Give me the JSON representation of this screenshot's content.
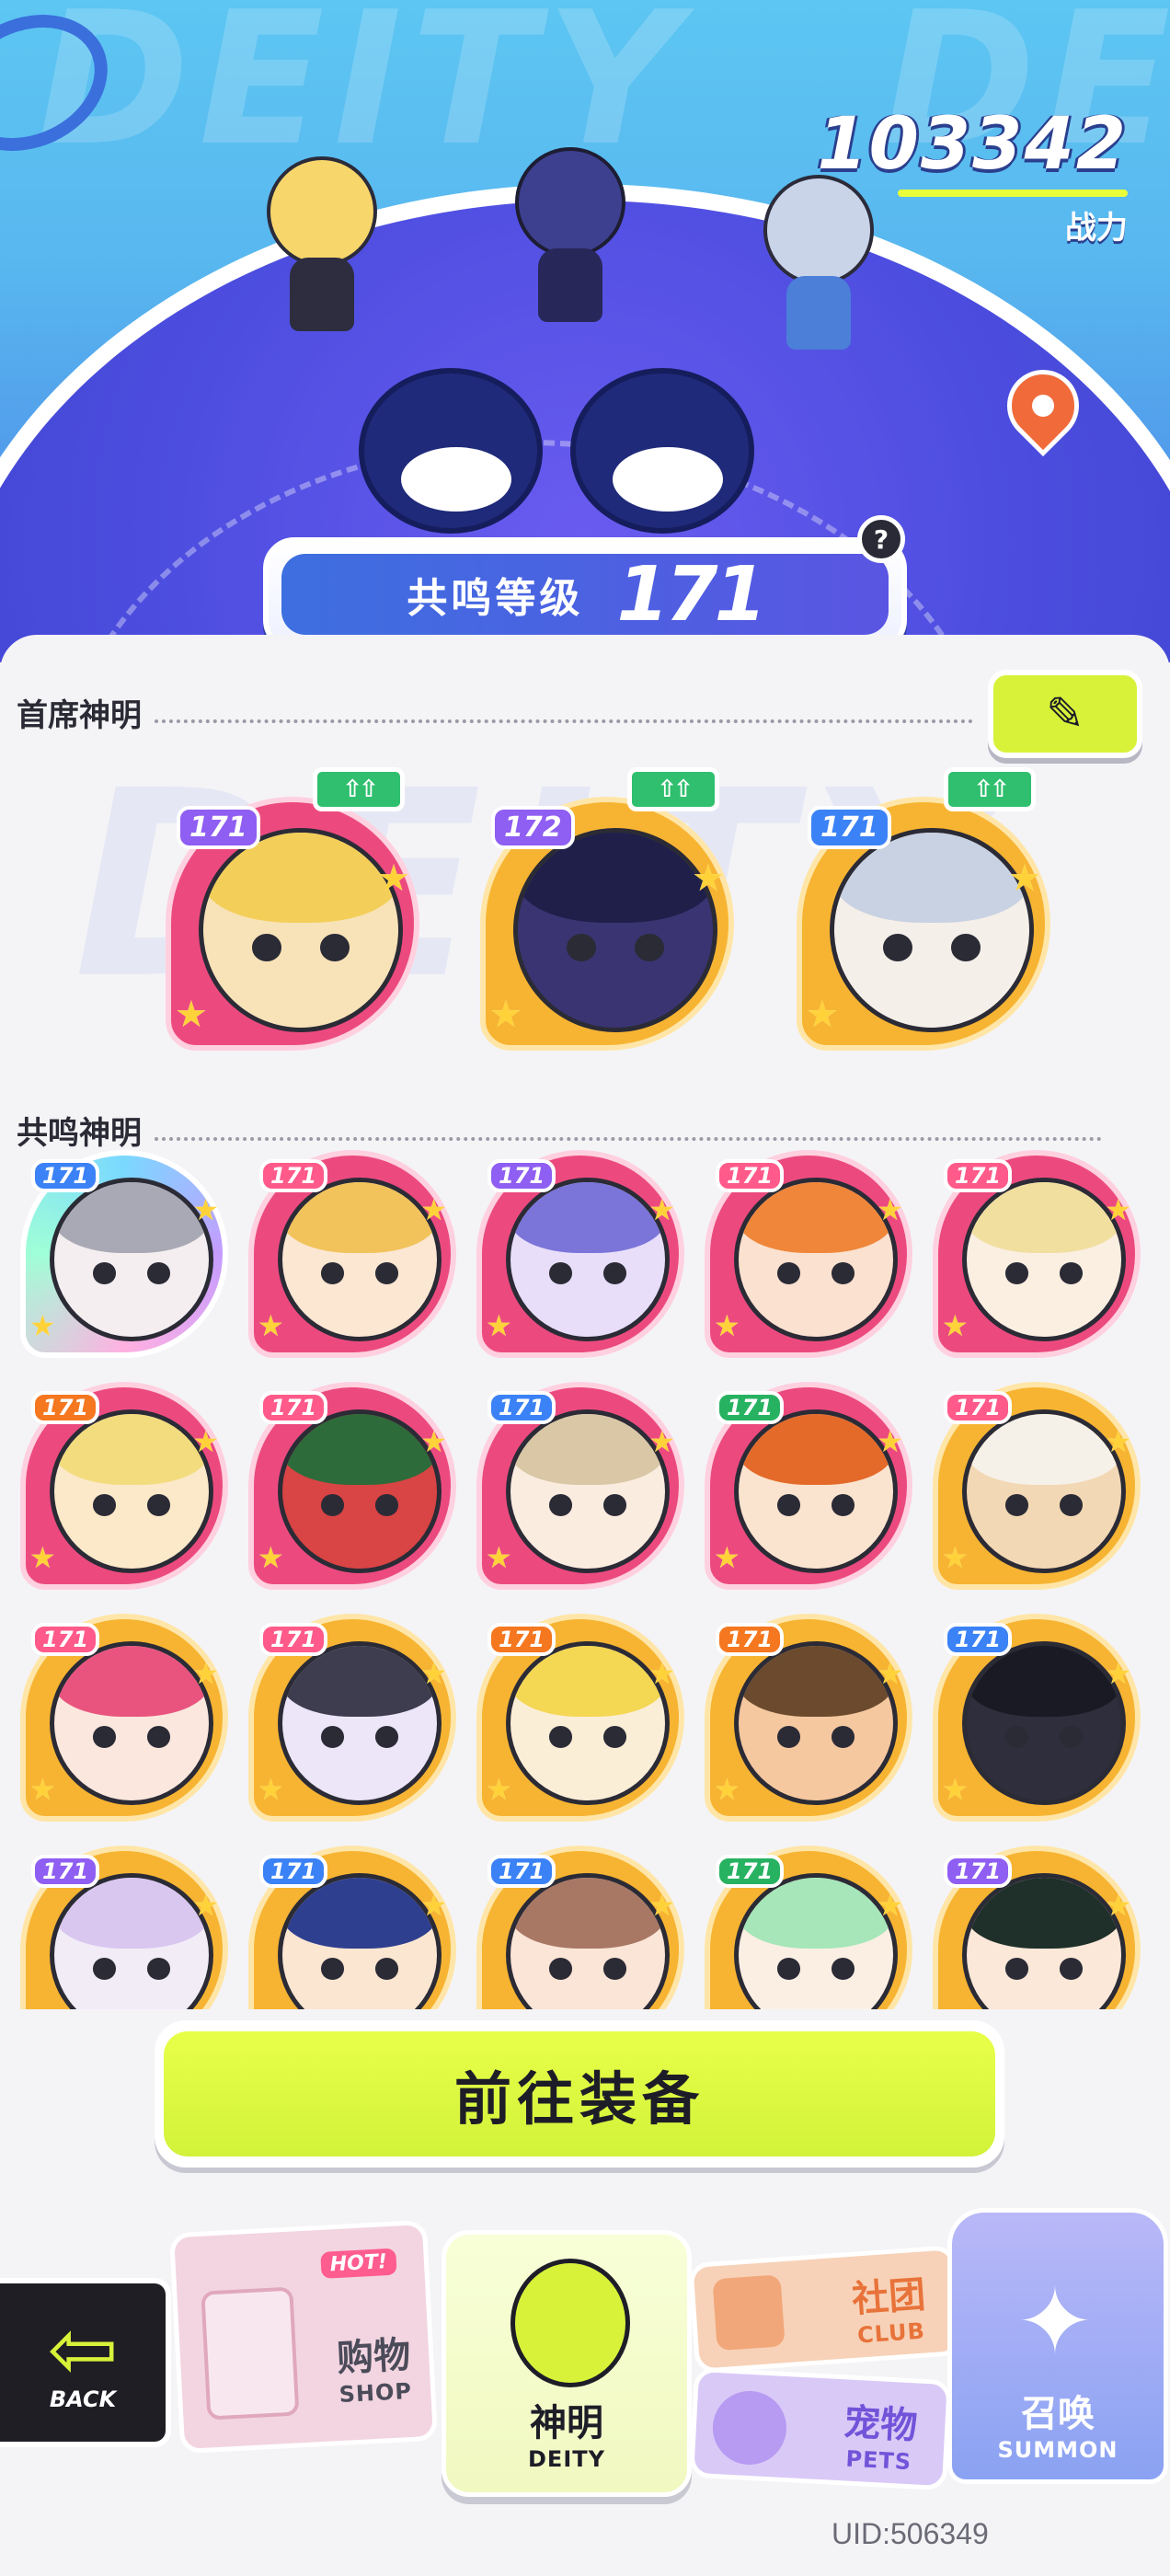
{
  "power": {
    "value": "103342",
    "label": "战力"
  },
  "resonance": {
    "label": "共鸣等级",
    "level": "171",
    "help": "?"
  },
  "sections": {
    "top_deities": "首席神明",
    "resonance_deities": "共鸣神明"
  },
  "top_deities": [
    {
      "level": "171",
      "frame": "pink",
      "lvl_color": "lpurple",
      "face": "#f8e3b8",
      "hair": "#f3cf5a",
      "upgrade": "⇧⇧"
    },
    {
      "level": "172",
      "frame": "gold",
      "lvl_color": "lpurple",
      "face": "#3a3472",
      "hair": "#1f1f4a",
      "upgrade": "⇧⇧"
    },
    {
      "level": "171",
      "frame": "gold",
      "lvl_color": "lblue",
      "face": "#f5efe9",
      "hair": "#c8d2e2",
      "upgrade": "⇧⇧"
    }
  ],
  "resonance_deities": [
    {
      "level": "171",
      "frame": "holo",
      "lvl_color": "lblue",
      "face": "#f4eef0",
      "hair": "#a9a9b5"
    },
    {
      "level": "171",
      "frame": "pink",
      "lvl_color": "lpink",
      "face": "#fbe7d2",
      "hair": "#f2c35b"
    },
    {
      "level": "171",
      "frame": "pink",
      "lvl_color": "lpurple",
      "face": "#e8defa",
      "hair": "#7b74d9"
    },
    {
      "level": "171",
      "frame": "pink",
      "lvl_color": "lpink",
      "face": "#fbe1cf",
      "hair": "#f0863a"
    },
    {
      "level": "171",
      "frame": "pink",
      "lvl_color": "lpink",
      "face": "#fbefe1",
      "hair": "#f1dfa0"
    },
    {
      "level": "171",
      "frame": "pink",
      "lvl_color": "lorange",
      "face": "#fbe9c9",
      "hair": "#f3dc7e"
    },
    {
      "level": "171",
      "frame": "pink",
      "lvl_color": "lpink",
      "face": "#d94444",
      "hair": "#2e6b3a"
    },
    {
      "level": "171",
      "frame": "pink",
      "lvl_color": "lblue",
      "face": "#fbece0",
      "hair": "#d9c7a6"
    },
    {
      "level": "171",
      "frame": "pink",
      "lvl_color": "lgreen",
      "face": "#fbe4cf",
      "hair": "#e46a2a"
    },
    {
      "level": "171",
      "frame": "gold",
      "lvl_color": "lpink",
      "face": "#f3d8b5",
      "hair": "#f6f1e8"
    },
    {
      "level": "171",
      "frame": "gold",
      "lvl_color": "lpink",
      "face": "#fbe7dd",
      "hair": "#e9547f"
    },
    {
      "level": "171",
      "frame": "gold",
      "lvl_color": "lpink",
      "face": "#ece6f8",
      "hair": "#3d3d4f"
    },
    {
      "level": "171",
      "frame": "gold",
      "lvl_color": "lorange",
      "face": "#fbeed7",
      "hair": "#f4d752"
    },
    {
      "level": "171",
      "frame": "gold",
      "lvl_color": "lorange",
      "face": "#f5c8a0",
      "hair": "#6b4a2e"
    },
    {
      "level": "171",
      "frame": "gold",
      "lvl_color": "lblue",
      "face": "#2e2e3c",
      "hair": "#1a1a24"
    },
    {
      "level": "171",
      "frame": "gold",
      "lvl_color": "lpurple",
      "face": "#f2ecf7",
      "hair": "#d9c7f0"
    },
    {
      "level": "171",
      "frame": "gold",
      "lvl_color": "lblue",
      "face": "#fbe6d2",
      "hair": "#2f3f8f"
    },
    {
      "level": "171",
      "frame": "gold",
      "lvl_color": "lblue",
      "face": "#fbe5d6",
      "hair": "#a87865"
    },
    {
      "level": "171",
      "frame": "gold",
      "lvl_color": "lgreen",
      "face": "#fbefe4",
      "hair": "#a6e6b9"
    },
    {
      "level": "171",
      "frame": "gold",
      "lvl_color": "lpurple",
      "face": "#fbe8d8",
      "hair": "#1f2f2a"
    }
  ],
  "cta": {
    "label": "前往装备"
  },
  "nav": {
    "back": "BACK",
    "shop_zh": "购物",
    "shop_en": "SHOP",
    "shop_badge": "HOT!",
    "deity_zh": "神明",
    "deity_en": "DEITY",
    "club_zh": "社团",
    "club_en": "CLUB",
    "pets_zh": "宠物",
    "pets_en": "PETS",
    "summon_zh": "召唤",
    "summon_en": "SUMMON"
  },
  "uid": "UID:506349",
  "icons": {
    "edit": "pencil-icon",
    "help": "question-icon",
    "back": "arrow-left-icon",
    "pin": "location-pin-icon"
  },
  "colors": {
    "accent_lime": "#d8f23a",
    "hero_blue": "#5dc6f2",
    "globe_indigo": "#4d4ee0",
    "frame_pink": "#ec4a7f",
    "frame_gold": "#f7b432"
  }
}
